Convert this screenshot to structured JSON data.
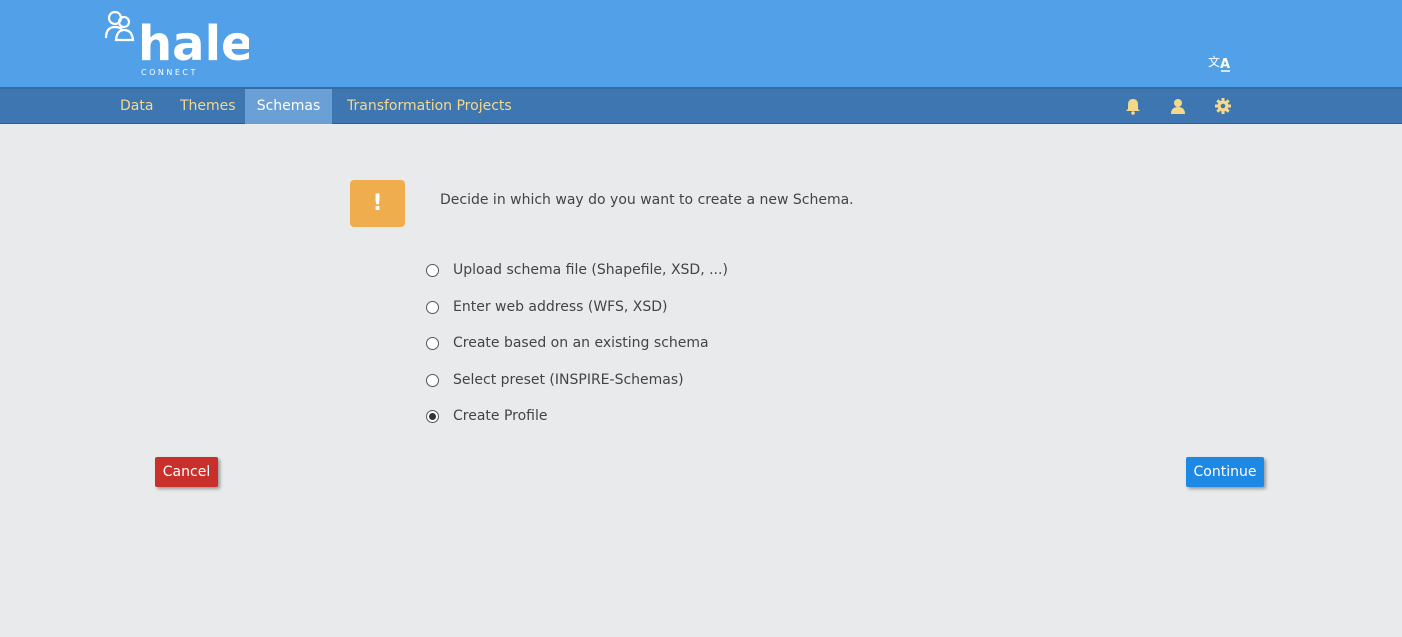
{
  "header": {
    "logo_text": "hale",
    "logo_subtext": "CONNECT",
    "language_icon": "translate-icon"
  },
  "nav": {
    "items": [
      {
        "label": "Data",
        "active": false
      },
      {
        "label": "Themes",
        "active": false
      },
      {
        "label": "Schemas",
        "active": true
      },
      {
        "label": "Transformation Projects",
        "active": false
      }
    ],
    "icons": [
      "bell-icon",
      "user-icon",
      "gear-icon"
    ]
  },
  "main": {
    "prompt": "Decide in which way do you want to create a new Schema.",
    "warning_symbol": "!",
    "options": [
      {
        "label": "Upload schema file (Shapefile, XSD, ...)",
        "checked": false
      },
      {
        "label": "Enter web address (WFS, XSD)",
        "checked": false
      },
      {
        "label": "Create based on an existing schema",
        "checked": false
      },
      {
        "label": "Select preset (INSPIRE-Schemas)",
        "checked": false
      },
      {
        "label": "Create Profile",
        "checked": true
      }
    ]
  },
  "actions": {
    "cancel_label": "Cancel",
    "continue_label": "Continue"
  },
  "colors": {
    "header_bg": "#51a0e8",
    "nav_bg": "#3e76b1",
    "nav_text": "#f5d98b",
    "warning": "#f0ad4e",
    "cancel": "#c9302c",
    "continue": "#1e88e5"
  }
}
